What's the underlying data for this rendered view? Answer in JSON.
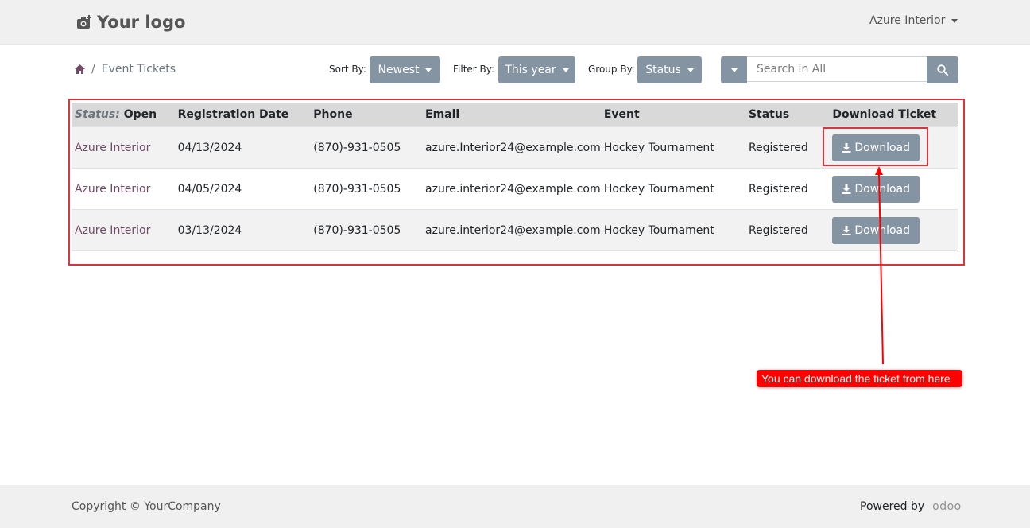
{
  "header": {
    "logo_text": "Your logo",
    "user_name": "Azure Interior"
  },
  "breadcrumb": {
    "separator": "/",
    "current": "Event Tickets"
  },
  "controls": {
    "sort_label": "Sort By:",
    "sort_value": "Newest",
    "filter_label": "Filter By:",
    "filter_value": "This year",
    "group_label": "Group By:",
    "group_value": "Status",
    "search_placeholder": "Search in All"
  },
  "table": {
    "group_caption": "Status:",
    "group_value": "Open",
    "columns": [
      "Registration Date",
      "Phone",
      "Email",
      "Event",
      "Status",
      "Download Ticket"
    ],
    "rows": [
      {
        "name": "Azure Interior",
        "date": "04/13/2024",
        "phone": "(870)-931-0505",
        "email": "azure.Interior24@example.com",
        "event": "Hockey Tournament",
        "status": "Registered",
        "action": "Download"
      },
      {
        "name": "Azure Interior",
        "date": "04/05/2024",
        "phone": "(870)-931-0505",
        "email": "azure.interior24@example.com",
        "event": "Hockey Tournament",
        "status": "Registered",
        "action": "Download"
      },
      {
        "name": "Azure Interior",
        "date": "03/13/2024",
        "phone": "(870)-931-0505",
        "email": "azure.interior24@example.com",
        "event": "Hockey Tournament",
        "status": "Registered",
        "action": "Download"
      }
    ]
  },
  "annotation": {
    "note": "You can download the ticket from here",
    "color": "#ff0000"
  },
  "footer": {
    "copyright": "Copyright © YourCompany",
    "powered_by": "Powered by",
    "brand": "odoo"
  },
  "colors": {
    "button": "#8594a3",
    "partner_link": "#714b67",
    "highlight": "#d9363e"
  }
}
